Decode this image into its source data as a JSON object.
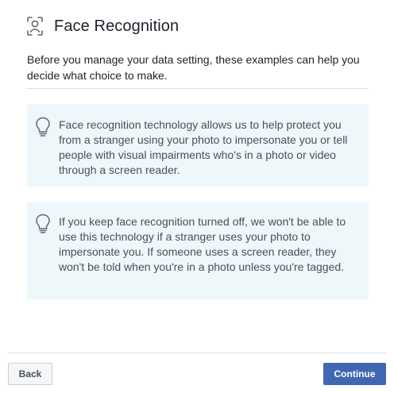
{
  "header": {
    "icon": "face-recognition-icon",
    "title": "Face Recognition"
  },
  "intro_text": "Before you manage your data setting, these examples can help you decide what choice to make.",
  "examples": [
    {
      "icon": "lightbulb-icon",
      "text": "Face recognition technology allows us to help protect you from a stranger using your photo to impersonate you or tell people with visual impairments who's in a photo or video through a screen reader."
    },
    {
      "icon": "lightbulb-icon",
      "text": "If you keep face recognition turned off, we won't be able to use this technology if a stranger uses your photo to impersonate you. If someone uses a screen reader, they won't be told when you're in a photo unless you're tagged."
    }
  ],
  "footer": {
    "back_label": "Back",
    "continue_label": "Continue"
  },
  "colors": {
    "card_background": "#eef8fb",
    "primary_button": "#4267b2",
    "icon_stroke": "#606770"
  }
}
